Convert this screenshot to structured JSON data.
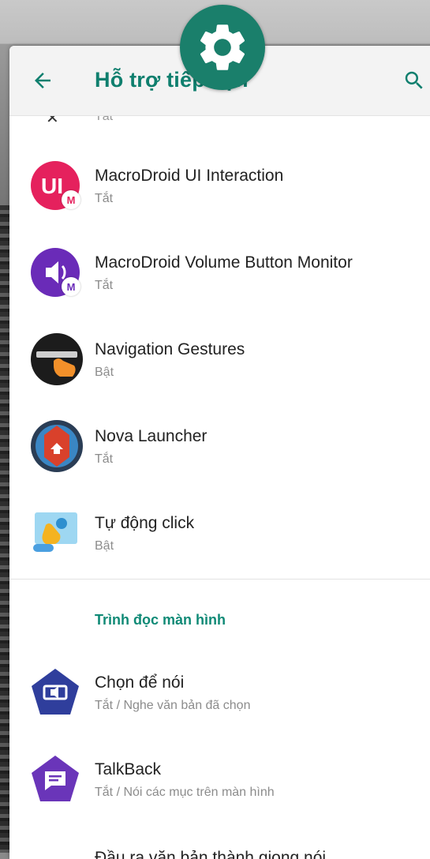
{
  "appbar": {
    "title": "Hỗ trợ tiếp cận"
  },
  "cut_item": {
    "sub": "Tắt"
  },
  "items": [
    {
      "label": "MacroDroid UI Interaction",
      "sub": "Tắt",
      "icon": "macrodroid-ui-icon"
    },
    {
      "label": "MacroDroid Volume Button Monitor",
      "sub": "Tắt",
      "icon": "macrodroid-volume-icon"
    },
    {
      "label": "Navigation Gestures",
      "sub": "Bật",
      "icon": "navigation-gestures-icon"
    },
    {
      "label": "Nova Launcher",
      "sub": "Tắt",
      "icon": "nova-launcher-icon"
    },
    {
      "label": "Tự động click",
      "sub": "Bật",
      "icon": "auto-click-icon"
    }
  ],
  "section": {
    "header": "Trình đọc màn hình",
    "items": [
      {
        "label": "Chọn để nói",
        "sub": "Tắt / Nghe văn bản đã chọn",
        "icon": "select-to-speak-icon"
      },
      {
        "label": "TalkBack",
        "sub": "Tắt / Nói các mục trên màn hình",
        "icon": "talkback-icon"
      },
      {
        "label": "Đầu ra văn bản thành giọng nói"
      }
    ]
  },
  "colors": {
    "accent": "#0f7f6e",
    "gear_badge": "#1a7f6b",
    "macrodroid_ui": "#e5215d",
    "macrodroid_volume": "#6a2bb8",
    "select_to_speak": "#2f3e9c",
    "talkback": "#6a35b9"
  }
}
